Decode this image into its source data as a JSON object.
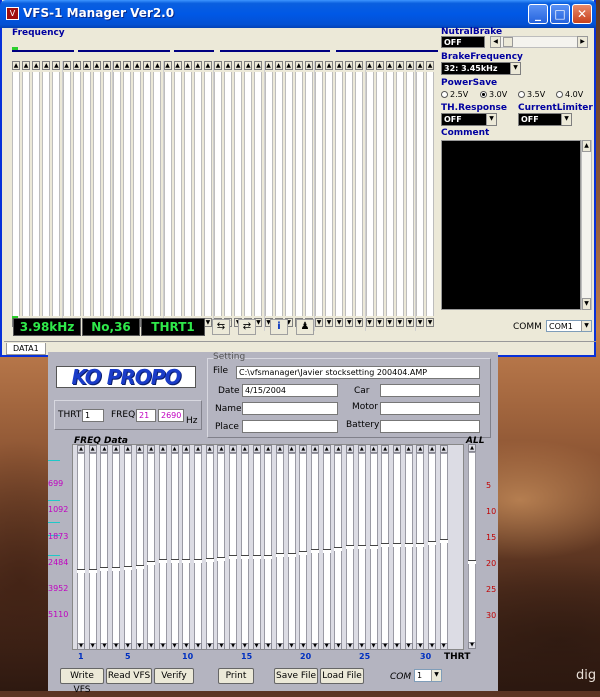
{
  "window": {
    "title": "VFS-1 Manager Ver2.0",
    "min": "_",
    "max": "□",
    "close": "✕"
  },
  "frequency": {
    "label": "Frequency",
    "columns": 42,
    "status_freq": "3.98kHz",
    "status_no": "No,36",
    "status_thrt": "THRT1"
  },
  "settings": {
    "nutral_brake_label": "NutralBrake",
    "nutral_brake_value": "OFF",
    "brake_freq_label": "BrakeFrequency",
    "brake_freq_value": "32: 3.45kHz",
    "power_save_label": "PowerSave",
    "power_options": [
      "2.5V",
      "3.0V",
      "3.5V",
      "4.0V"
    ],
    "power_selected": "3.0V",
    "th_response_label": "TH.Response",
    "th_response_value": "OFF",
    "current_limiter_label": "CurrentLimiter",
    "current_limiter_value": "OFF",
    "comment_label": "Comment",
    "comm_label": "COMM",
    "comm_value": "COM1"
  },
  "tabs": [
    "DATA1"
  ],
  "kopropo": {
    "logo": "KO PROPO",
    "thrt_label": "THRT",
    "thrt_value": "1",
    "freq_label": "FREQ",
    "freq_value": "21",
    "freq_hz": "2690",
    "hz_label": "Hz",
    "setting_label": "Setting",
    "file_label": "File",
    "file_value": "C:\\vfsmanager\\Javier stocksetting 200404.AMP",
    "date_label": "Date",
    "date_value": "4/15/2004",
    "name_label": "Name",
    "place_label": "Place",
    "car_label": "Car",
    "motor_label": "Motor",
    "battery_label": "Battery",
    "freq_data_label": "FREQ Data",
    "all_label": "ALL",
    "left_axis": [
      "699",
      "1092",
      "1873",
      "2484",
      "3952",
      "5110"
    ],
    "right_axis": [
      "5",
      "10",
      "15",
      "20",
      "25",
      "30"
    ],
    "x_axis": [
      "1",
      "5",
      "10",
      "15",
      "20",
      "25",
      "30"
    ],
    "thrt_axis": "THRT",
    "buttons": {
      "write": "Write VFS",
      "read": "Read VFS",
      "verify": "Verify",
      "print": "Print",
      "save": "Save File",
      "load": "Load File"
    },
    "com_label": "COM",
    "com_value": "1"
  },
  "desktop": {
    "corner_text": "dig"
  }
}
